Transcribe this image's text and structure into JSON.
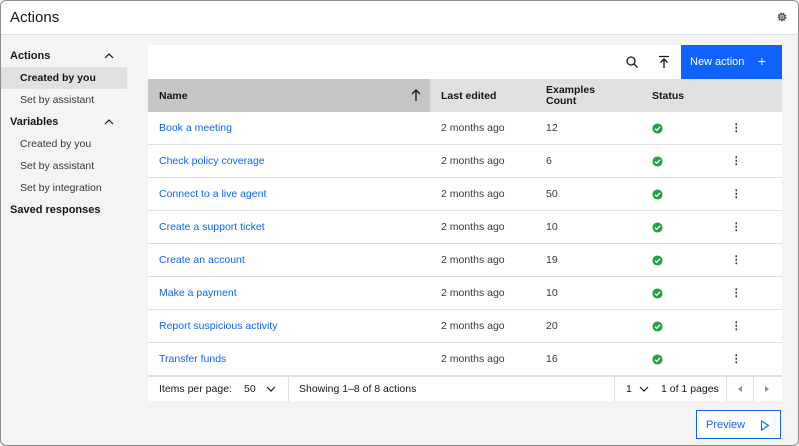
{
  "app": {
    "title": "Actions",
    "settings_icon": "gear-icon"
  },
  "sidebar": {
    "sections": [
      {
        "label": "Actions",
        "expanded": true,
        "items": [
          {
            "label": "Created by you",
            "active": true
          },
          {
            "label": "Set by assistant",
            "active": false
          }
        ]
      },
      {
        "label": "Variables",
        "expanded": true,
        "items": [
          {
            "label": "Created by you",
            "active": false
          },
          {
            "label": "Set by assistant",
            "active": false
          },
          {
            "label": "Set by integration",
            "active": false
          }
        ]
      },
      {
        "label": "Saved responses",
        "expanded": false,
        "items": []
      }
    ]
  },
  "toolbar": {
    "search_icon": "search-icon",
    "upload_icon": "upload-icon",
    "new_action_label": "New action",
    "new_action_icon": "+"
  },
  "table": {
    "columns": {
      "name": "Name",
      "last_edited": "Last edited",
      "examples_line1": "Examples",
      "examples_line2": "Count",
      "status": "Status"
    },
    "sort": {
      "column": "name",
      "direction": "ascending"
    },
    "rows": [
      {
        "name": "Book a meeting",
        "last_edited": "2 months ago",
        "examples": "12",
        "status": "complete"
      },
      {
        "name": "Check policy coverage",
        "last_edited": "2 months ago",
        "examples": "6",
        "status": "complete"
      },
      {
        "name": "Connect to a live agent",
        "last_edited": "2 months ago",
        "examples": "50",
        "status": "complete"
      },
      {
        "name": "Create a support ticket",
        "last_edited": "2 months ago",
        "examples": "10",
        "status": "complete"
      },
      {
        "name": "Create an account",
        "last_edited": "2 months ago",
        "examples": "19",
        "status": "complete"
      },
      {
        "name": "Make a payment",
        "last_edited": "2 months ago",
        "examples": "10",
        "status": "complete"
      },
      {
        "name": "Report suspicious activity",
        "last_edited": "2 months ago",
        "examples": "20",
        "status": "complete"
      },
      {
        "name": "Transfer funds",
        "last_edited": "2 months ago",
        "examples": "16",
        "status": "complete"
      }
    ]
  },
  "pagination": {
    "items_per_page_label": "Items per page:",
    "items_per_page_value": "50",
    "range_text": "Showing 1–8 of 8 actions",
    "current_page": "1",
    "pages_text": "1 of 1 pages"
  },
  "preview": {
    "label": "Preview",
    "icon": "play-icon"
  },
  "colors": {
    "accent": "#0f62fe",
    "status_ok": "#24a148",
    "header_bg": "#e0e0e0",
    "sorted_header_bg": "#c6c6c6"
  }
}
